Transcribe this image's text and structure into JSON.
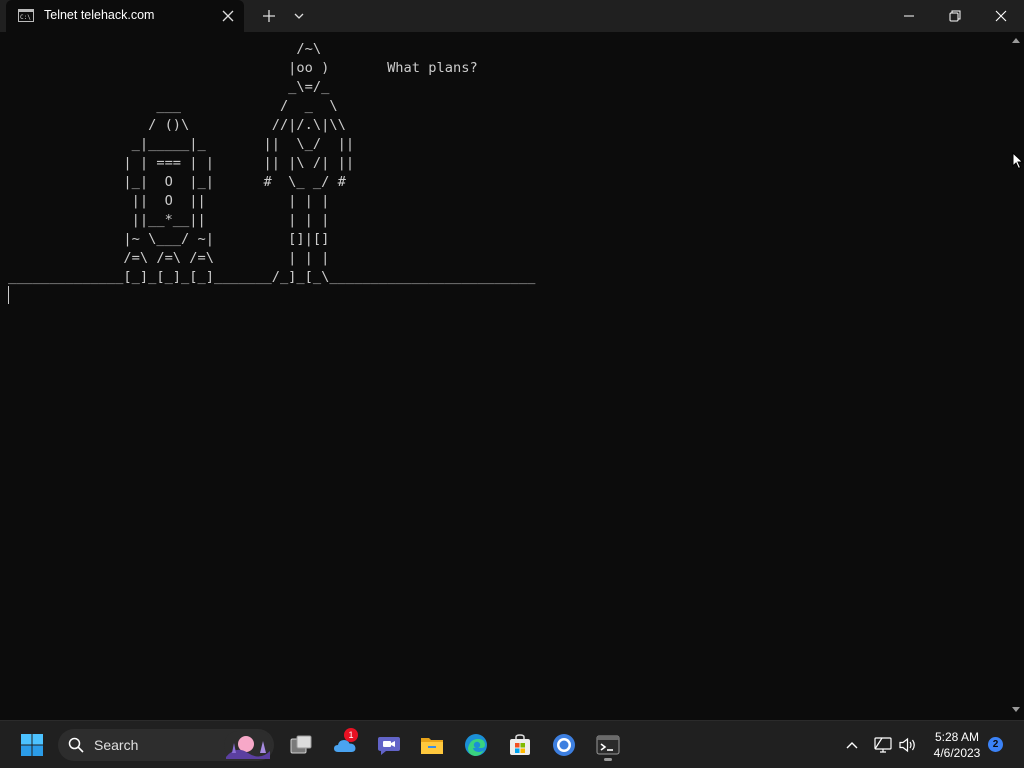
{
  "window": {
    "tab_title": "Telnet telehack.com",
    "icons": {
      "tab": "console-icon",
      "close_tab": "close-icon",
      "new_tab": "plus-icon",
      "dropdown": "chevron-down-icon",
      "minimize": "minimize-icon",
      "maximize": "restore-icon",
      "close": "close-icon"
    }
  },
  "terminal": {
    "lines": [
      "                                   /~\\",
      "                                  |oo )       What plans?",
      "                                  _\\=/_",
      "                  ___            /  _  \\",
      "                 / ()\\          //|/.\\|\\\\",
      "               _|_____|_       ||  \\_/  ||",
      "              | | === | |      || |\\ /| ||",
      "              |_|  O  |_|      #  \\_ _/ #",
      "               ||  O  ||          | | |",
      "               ||__*__||          | | |",
      "              |~ \\___/ ~|         []|[]",
      "              /=\\ /=\\ /=\\         | | |",
      "______________[_]_[_]_[_]_______/_]_[_\\_________________________"
    ],
    "foreground": "#cccccc",
    "background": "#0c0c0c"
  },
  "taskbar": {
    "search_label": "Search",
    "apps": [
      {
        "name": "start-icon"
      },
      {
        "name": "task-view-icon"
      },
      {
        "name": "onedrive-icon",
        "badge": "1"
      },
      {
        "name": "teams-chat-icon"
      },
      {
        "name": "file-explorer-icon"
      },
      {
        "name": "edge-icon"
      },
      {
        "name": "store-icon"
      },
      {
        "name": "browser-icon"
      },
      {
        "name": "terminal-icon"
      }
    ],
    "tray": {
      "time": "5:28 AM",
      "date": "4/6/2023",
      "notifications": "2"
    }
  }
}
